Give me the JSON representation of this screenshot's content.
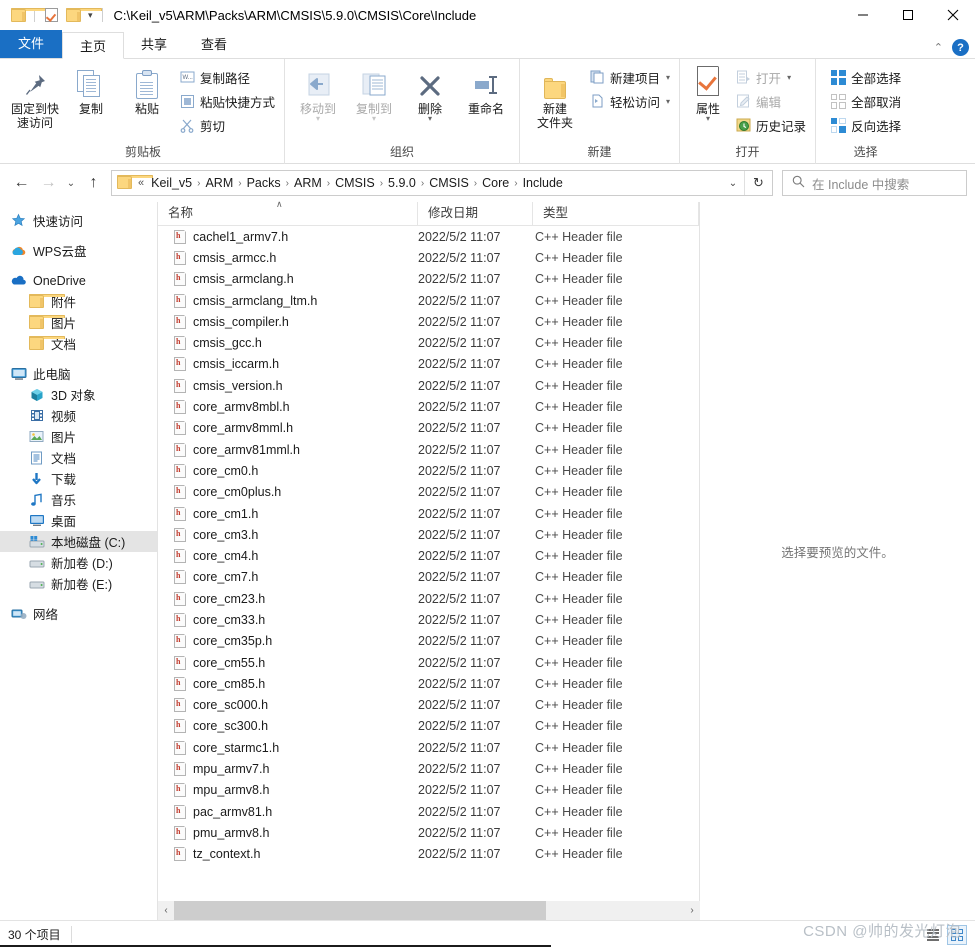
{
  "window": {
    "path_title": "C:\\Keil_v5\\ARM\\Packs\\ARM\\CMSIS\\5.9.0\\CMSIS\\Core\\Include",
    "minimize_label": "–",
    "maximize_label": "☐",
    "close_label": "✕",
    "qat_caret": "▾",
    "accent_color": "#1a6fc4"
  },
  "tabs": {
    "file": "文件",
    "items": [
      {
        "label": "主页",
        "active": true
      },
      {
        "label": "共享",
        "active": false
      },
      {
        "label": "查看",
        "active": false
      }
    ],
    "collapse_caret": "⌃",
    "help_label": "?"
  },
  "ribbon": {
    "groups": [
      {
        "name": "clipboard",
        "label": "剪贴板",
        "big": [
          {
            "label_line1": "固定到快",
            "label_line2": "速访问",
            "icon": "pin-icon"
          },
          {
            "label_line1": "复制",
            "label_line2": "",
            "icon": "copy-icon"
          },
          {
            "label_line1": "粘贴",
            "label_line2": "",
            "icon": "paste-icon"
          }
        ],
        "small": [
          {
            "label": "复制路径",
            "icon": "copy-path-icon"
          },
          {
            "label": "粘贴快捷方式",
            "icon": "paste-shortcut-icon"
          },
          {
            "label": "剪切",
            "icon": "scissors-icon"
          }
        ]
      },
      {
        "name": "organize",
        "label": "组织",
        "big": [
          {
            "label_line1": "移动到",
            "label_line2": "",
            "icon": "move-to-icon",
            "dim": true,
            "caret": "▾"
          },
          {
            "label_line1": "复制到",
            "label_line2": "",
            "icon": "copy-to-icon",
            "dim": true,
            "caret": "▾"
          },
          {
            "label_line1": "删除",
            "label_line2": "",
            "icon": "delete-icon",
            "caret": "▾"
          },
          {
            "label_line1": "重命名",
            "label_line2": "",
            "icon": "rename-icon"
          }
        ],
        "small": []
      },
      {
        "name": "new",
        "label": "新建",
        "big": [
          {
            "label_line1": "新建",
            "label_line2": "文件夹",
            "icon": "new-folder-icon"
          }
        ],
        "small": [
          {
            "label": "新建项目",
            "icon": "new-item-icon",
            "caret": "▾"
          },
          {
            "label": "轻松访问",
            "icon": "easy-access-icon",
            "caret": "▾"
          }
        ]
      },
      {
        "name": "open",
        "label": "打开",
        "big": [
          {
            "label_line1": "属性",
            "label_line2": "",
            "icon": "properties-icon",
            "caret": "▾"
          }
        ],
        "small": [
          {
            "label": "打开",
            "icon": "open-icon",
            "dim": true,
            "caret": "▾"
          },
          {
            "label": "编辑",
            "icon": "edit-icon",
            "dim": true
          },
          {
            "label": "历史记录",
            "icon": "history-icon"
          }
        ]
      },
      {
        "name": "select",
        "label": "选择",
        "big": [],
        "small": [
          {
            "label": "全部选择",
            "icon": "select-all-icon"
          },
          {
            "label": "全部取消",
            "icon": "select-none-icon"
          },
          {
            "label": "反向选择",
            "icon": "invert-selection-icon"
          }
        ]
      }
    ]
  },
  "addressbar": {
    "back_icon": "←",
    "forward_icon": "→",
    "recent_caret": "⌄",
    "up_icon": "↑",
    "root_chevron": "«",
    "crumbs": [
      "Keil_v5",
      "ARM",
      "Packs",
      "ARM",
      "CMSIS",
      "5.9.0",
      "CMSIS",
      "Core",
      "Include"
    ],
    "separator": "›",
    "dropdown_caret": "⌄",
    "refresh_icon": "↻",
    "search_placeholder": "在 Include 中搜索",
    "search_value": ""
  },
  "sidebar": {
    "items": [
      {
        "label": "快速访问",
        "icon": "quick-access-star-icon",
        "indent": 0,
        "selected": false,
        "gap_before": false
      },
      {
        "label": "WPS云盘",
        "icon": "wps-cloud-icon",
        "indent": 0,
        "selected": false,
        "gap_before": true
      },
      {
        "label": "OneDrive",
        "icon": "onedrive-cloud-icon",
        "indent": 0,
        "selected": false,
        "gap_before": true
      },
      {
        "label": "附件",
        "icon": "folder-icon",
        "indent": 1,
        "selected": false,
        "gap_before": false
      },
      {
        "label": "图片",
        "icon": "folder-icon",
        "indent": 1,
        "selected": false,
        "gap_before": false
      },
      {
        "label": "文档",
        "icon": "folder-icon",
        "indent": 1,
        "selected": false,
        "gap_before": false
      },
      {
        "label": "此电脑",
        "icon": "this-pc-icon",
        "indent": 0,
        "selected": false,
        "gap_before": true
      },
      {
        "label": "3D 对象",
        "icon": "3d-objects-icon",
        "indent": 1,
        "selected": false,
        "gap_before": false
      },
      {
        "label": "视频",
        "icon": "videos-icon",
        "indent": 1,
        "selected": false,
        "gap_before": false
      },
      {
        "label": "图片",
        "icon": "pictures-icon",
        "indent": 1,
        "selected": false,
        "gap_before": false
      },
      {
        "label": "文档",
        "icon": "documents-icon",
        "indent": 1,
        "selected": false,
        "gap_before": false
      },
      {
        "label": "下载",
        "icon": "downloads-icon",
        "indent": 1,
        "selected": false,
        "gap_before": false
      },
      {
        "label": "音乐",
        "icon": "music-icon",
        "indent": 1,
        "selected": false,
        "gap_before": false
      },
      {
        "label": "桌面",
        "icon": "desktop-icon",
        "indent": 1,
        "selected": false,
        "gap_before": false
      },
      {
        "label": "本地磁盘 (C:)",
        "icon": "system-drive-icon",
        "indent": 1,
        "selected": true,
        "gap_before": false
      },
      {
        "label": "新加卷 (D:)",
        "icon": "drive-icon",
        "indent": 1,
        "selected": false,
        "gap_before": false
      },
      {
        "label": "新加卷 (E:)",
        "icon": "drive-icon",
        "indent": 1,
        "selected": false,
        "gap_before": false
      },
      {
        "label": "网络",
        "icon": "network-icon",
        "indent": 0,
        "selected": false,
        "gap_before": true
      }
    ]
  },
  "filelist": {
    "columns": [
      {
        "label": "名称",
        "key": "name",
        "sorted": "asc",
        "sort_caret": "∧"
      },
      {
        "label": "修改日期",
        "key": "date",
        "sorted": ""
      },
      {
        "label": "类型",
        "key": "type",
        "sorted": ""
      }
    ],
    "icon_letter": "h",
    "rows": [
      {
        "name": "cachel1_armv7.h",
        "date": "2022/5/2 11:07",
        "type": "C++ Header file"
      },
      {
        "name": "cmsis_armcc.h",
        "date": "2022/5/2 11:07",
        "type": "C++ Header file"
      },
      {
        "name": "cmsis_armclang.h",
        "date": "2022/5/2 11:07",
        "type": "C++ Header file"
      },
      {
        "name": "cmsis_armclang_ltm.h",
        "date": "2022/5/2 11:07",
        "type": "C++ Header file"
      },
      {
        "name": "cmsis_compiler.h",
        "date": "2022/5/2 11:07",
        "type": "C++ Header file"
      },
      {
        "name": "cmsis_gcc.h",
        "date": "2022/5/2 11:07",
        "type": "C++ Header file"
      },
      {
        "name": "cmsis_iccarm.h",
        "date": "2022/5/2 11:07",
        "type": "C++ Header file"
      },
      {
        "name": "cmsis_version.h",
        "date": "2022/5/2 11:07",
        "type": "C++ Header file"
      },
      {
        "name": "core_armv8mbl.h",
        "date": "2022/5/2 11:07",
        "type": "C++ Header file"
      },
      {
        "name": "core_armv8mml.h",
        "date": "2022/5/2 11:07",
        "type": "C++ Header file"
      },
      {
        "name": "core_armv81mml.h",
        "date": "2022/5/2 11:07",
        "type": "C++ Header file"
      },
      {
        "name": "core_cm0.h",
        "date": "2022/5/2 11:07",
        "type": "C++ Header file"
      },
      {
        "name": "core_cm0plus.h",
        "date": "2022/5/2 11:07",
        "type": "C++ Header file"
      },
      {
        "name": "core_cm1.h",
        "date": "2022/5/2 11:07",
        "type": "C++ Header file"
      },
      {
        "name": "core_cm3.h",
        "date": "2022/5/2 11:07",
        "type": "C++ Header file"
      },
      {
        "name": "core_cm4.h",
        "date": "2022/5/2 11:07",
        "type": "C++ Header file"
      },
      {
        "name": "core_cm7.h",
        "date": "2022/5/2 11:07",
        "type": "C++ Header file"
      },
      {
        "name": "core_cm23.h",
        "date": "2022/5/2 11:07",
        "type": "C++ Header file"
      },
      {
        "name": "core_cm33.h",
        "date": "2022/5/2 11:07",
        "type": "C++ Header file"
      },
      {
        "name": "core_cm35p.h",
        "date": "2022/5/2 11:07",
        "type": "C++ Header file"
      },
      {
        "name": "core_cm55.h",
        "date": "2022/5/2 11:07",
        "type": "C++ Header file"
      },
      {
        "name": "core_cm85.h",
        "date": "2022/5/2 11:07",
        "type": "C++ Header file"
      },
      {
        "name": "core_sc000.h",
        "date": "2022/5/2 11:07",
        "type": "C++ Header file"
      },
      {
        "name": "core_sc300.h",
        "date": "2022/5/2 11:07",
        "type": "C++ Header file"
      },
      {
        "name": "core_starmc1.h",
        "date": "2022/5/2 11:07",
        "type": "C++ Header file"
      },
      {
        "name": "mpu_armv7.h",
        "date": "2022/5/2 11:07",
        "type": "C++ Header file"
      },
      {
        "name": "mpu_armv8.h",
        "date": "2022/5/2 11:07",
        "type": "C++ Header file"
      },
      {
        "name": "pac_armv81.h",
        "date": "2022/5/2 11:07",
        "type": "C++ Header file"
      },
      {
        "name": "pmu_armv8.h",
        "date": "2022/5/2 11:07",
        "type": "C++ Header file"
      },
      {
        "name": "tz_context.h",
        "date": "2022/5/2 11:07",
        "type": "C++ Header file"
      }
    ]
  },
  "preview": {
    "empty_text": "选择要预览的文件。"
  },
  "scrollbar": {
    "left_arrow": "‹",
    "right_arrow": "›"
  },
  "statusbar": {
    "item_count_text": "30 个项目",
    "watermark": "CSDN @帅的发光灯泡"
  }
}
